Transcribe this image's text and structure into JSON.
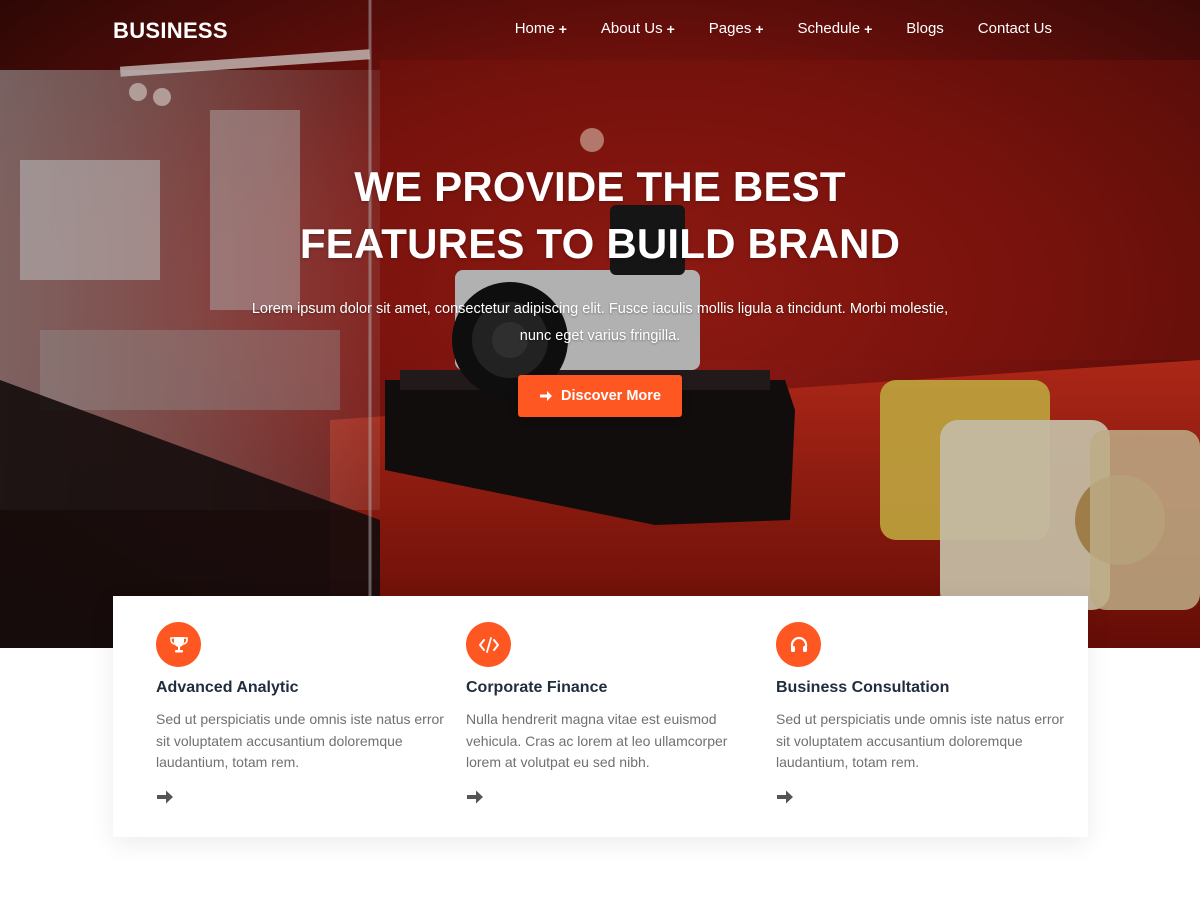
{
  "brand": "BUSINESS",
  "nav": {
    "items": [
      {
        "label": "Home",
        "has_submenu": true
      },
      {
        "label": "About Us",
        "has_submenu": true
      },
      {
        "label": "Pages",
        "has_submenu": true
      },
      {
        "label": "Schedule",
        "has_submenu": true
      },
      {
        "label": "Blogs",
        "has_submenu": false
      },
      {
        "label": "Contact Us",
        "has_submenu": false
      }
    ],
    "submenu_glyph": "+"
  },
  "hero": {
    "title_line1": "WE PROVIDE THE BEST",
    "title_line2": "FEATURES TO BUILD BRAND",
    "description_line1": "Lorem ipsum dolor sit amet, consectetur adipiscing elit. Fusce iaculis mollis ligula a tincidunt. Morbi molestie,",
    "description_line2": "nunc eget varius fringilla.",
    "cta_label": "Discover More"
  },
  "features": [
    {
      "icon": "trophy-icon",
      "title": "Advanced Analytic",
      "text": "Sed ut perspiciatis unde omnis iste natus error sit voluptatem accusantium doloremque laudantium, totam rem."
    },
    {
      "icon": "code-icon",
      "title": "Corporate Finance",
      "text": "Nulla hendrerit magna vitae est euismod vehicula. Cras ac lorem at leo ullamcorper lorem at volutpat eu sed nibh."
    },
    {
      "icon": "headphones-icon",
      "title": "Business Consultation",
      "text": "Sed ut perspiciatis unde omnis iste natus error sit voluptatem accusantium doloremque laudantium, totam rem."
    }
  ],
  "colors": {
    "accent": "#ff5722",
    "heading": "#1f2d3d",
    "body_text": "#707070"
  }
}
